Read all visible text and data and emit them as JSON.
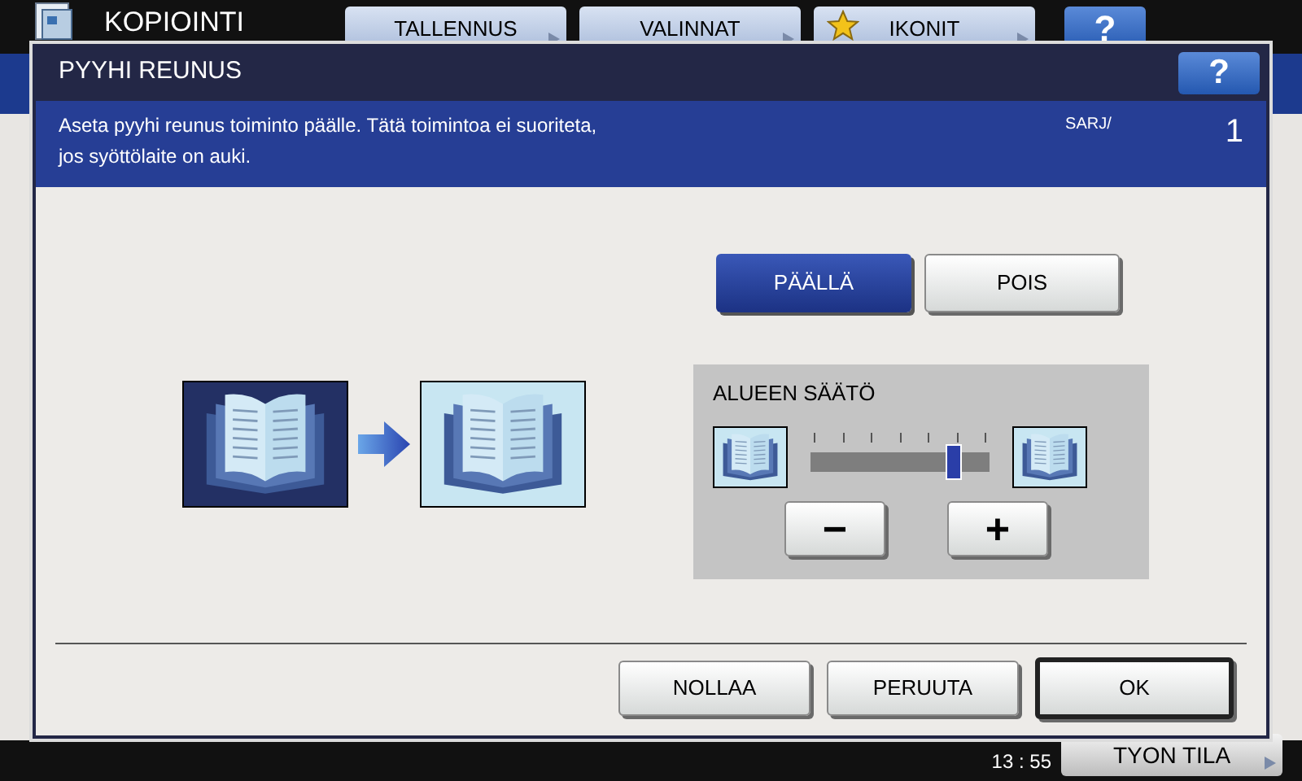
{
  "background": {
    "title": "KOPIOINTI",
    "tabs": [
      {
        "label": "TALLENNUS",
        "kind": "plain"
      },
      {
        "label": "VALINNAT",
        "kind": "plain"
      },
      {
        "label": "IKONIT",
        "kind": "star"
      }
    ],
    "help": "?",
    "status_button": "TYON TILA",
    "time": "13 : 55"
  },
  "dialog": {
    "title": "PYYHI REUNUS",
    "help": "?",
    "message": [
      "Aseta pyyhi reunus toiminto päälle. Tätä toimintoa ei suoriteta,",
      "jos syöttölaite on auki."
    ],
    "counter_label": "SARJ/",
    "counter": "1",
    "toggle": [
      {
        "label": "PÄÄLLÄ",
        "selected": true
      },
      {
        "label": "POIS",
        "selected": false
      }
    ],
    "adjust": {
      "title": "ALUEEN SÄÄTÖ",
      "level": 0.8,
      "minus": "−",
      "plus": "+"
    },
    "buttons": [
      {
        "label": "NOLLAA",
        "kind": "normal"
      },
      {
        "label": "PERUUTA",
        "kind": "normal"
      },
      {
        "label": "OK",
        "kind": "default"
      }
    ]
  }
}
